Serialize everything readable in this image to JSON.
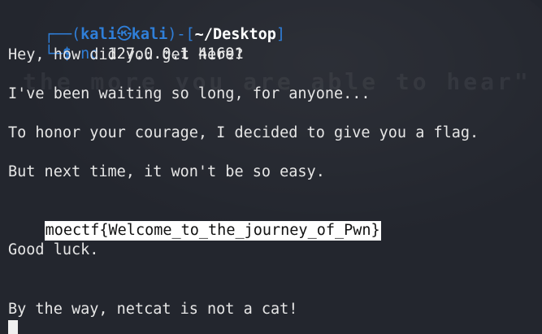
{
  "window": {
    "background_color": "#23262e",
    "accent_color": "#2f7fd9"
  },
  "prompt": {
    "corner_top": "┌──(",
    "user": "kali",
    "separator_icon": "kali-dragon-icon",
    "host": "kali",
    "close_paren": ")-[",
    "path": "~/Desktop",
    "bracket_close": "]",
    "corner_bottom": "└─",
    "dollar": "$"
  },
  "command": {
    "name": "nc",
    "args": " 127.0.0.1 41691"
  },
  "background": {
    "wallpaper_text": "the more you are able to hear\""
  },
  "output": {
    "line1": "Hey, how did you get here?",
    "line2": "I've been waiting so long, for anyone...",
    "line3": "To honor your courage, I decided to give you a flag.",
    "line4": "But next time, it won't be so easy.",
    "flag": "moectf{Welcome_to_the_journey_of_Pwn}",
    "line5": "Good luck.",
    "line6": "By the way, netcat is not a cat!"
  }
}
